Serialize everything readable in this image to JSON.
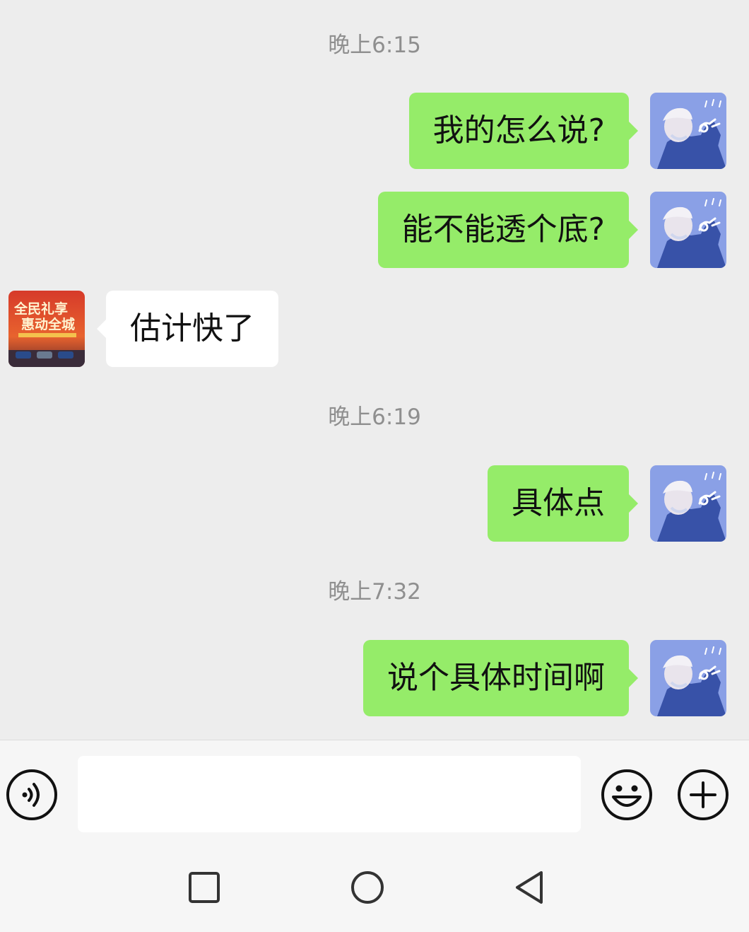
{
  "messages": [
    {
      "type": "timestamp",
      "text": "晚上6:15"
    },
    {
      "type": "outgoing",
      "text": "我的怎么说?"
    },
    {
      "type": "outgoing",
      "text": "能不能透个底?"
    },
    {
      "type": "incoming",
      "text": "估计快了"
    },
    {
      "type": "timestamp",
      "text": "晚上6:19"
    },
    {
      "type": "outgoing",
      "text": "具体点"
    },
    {
      "type": "timestamp",
      "text": "晚上7:32"
    },
    {
      "type": "outgoing",
      "text": "说个具体时间啊"
    }
  ],
  "other_avatar": {
    "line1": "全民礼享",
    "line2": "惠动全城"
  },
  "input": {
    "value": "",
    "placeholder": ""
  },
  "icons": {
    "voice": "voice-input-icon",
    "emoji": "emoji-icon",
    "plus": "plus-icon",
    "nav_recent": "square-recent-apps-icon",
    "nav_home": "circle-home-icon",
    "nav_back": "triangle-back-icon"
  },
  "colors": {
    "outgoing_bubble": "#95ec69",
    "incoming_bubble": "#ffffff",
    "chat_background": "#ededed",
    "timestamp_text": "#8f8f8f"
  }
}
